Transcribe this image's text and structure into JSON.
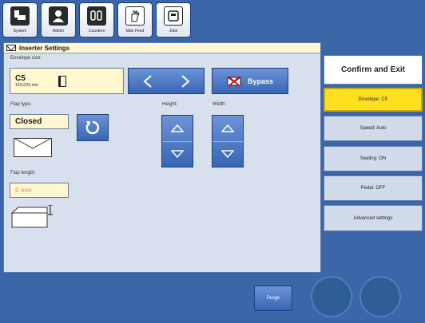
{
  "toolbar": {
    "buttons": [
      {
        "label": "System",
        "icon": "system-icon"
      },
      {
        "label": "Admin",
        "icon": "admin-icon"
      },
      {
        "label": "Counters",
        "icon": "counters-icon"
      },
      {
        "label": "Man Feed",
        "icon": "hand-icon"
      },
      {
        "label": "Jobs",
        "icon": "jobs-icon"
      }
    ]
  },
  "panel": {
    "title": "Inserter Settings",
    "envelope_size_label": "Envelope size:",
    "envelope_code": "C5",
    "envelope_dimensions": "162x229 mm",
    "bypass_label": "Bypass",
    "flap_type_label": "Flap type:",
    "flap_type_value": "Closed",
    "height_label": "Height:",
    "width_label": "Width:",
    "flap_length_label": "Flap length:",
    "flap_length_value": "0 mm"
  },
  "right_menu": {
    "confirm_label": "Confirm and Exit",
    "envelope_label": "Envelope: C5",
    "speed_label": "Speed: Auto",
    "sealing_label": "Sealing: ON",
    "pedal_label": "Pedal: OFF",
    "advanced_label": "Advanced settings"
  },
  "bottom": {
    "purge_label": "Purge"
  },
  "colors": {
    "background": "#3b66a8",
    "highlight": "#ffdf1e",
    "input_bg": "#fff7d0"
  }
}
